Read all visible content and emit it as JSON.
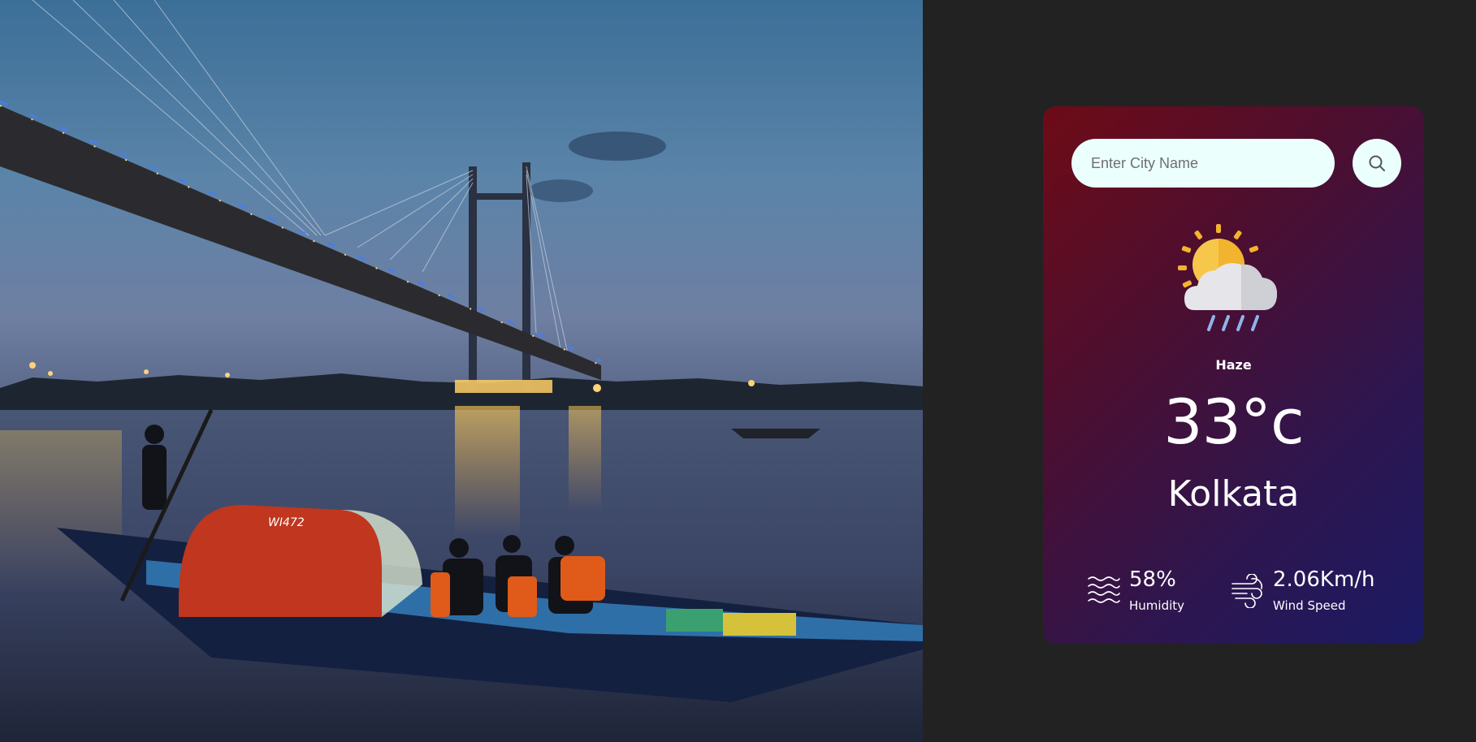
{
  "search": {
    "placeholder": "Enter City Name"
  },
  "weather": {
    "condition": "Haze",
    "temperature": "33°c",
    "city": "Kolkata",
    "icon": "sun-cloud-rain-icon"
  },
  "details": {
    "humidity": {
      "value": "58%",
      "label": "Humidity",
      "icon": "humidity-waves-icon"
    },
    "wind": {
      "value": "2.06Km/h",
      "label": "Wind Speed",
      "icon": "wind-icon"
    }
  },
  "photo": {
    "boat_label": "WI472"
  },
  "colors": {
    "page_background": "#222222",
    "card_gradient_start": "#6e0b16",
    "card_gradient_end": "#1b1a63",
    "input_background": "#ebfffc"
  }
}
